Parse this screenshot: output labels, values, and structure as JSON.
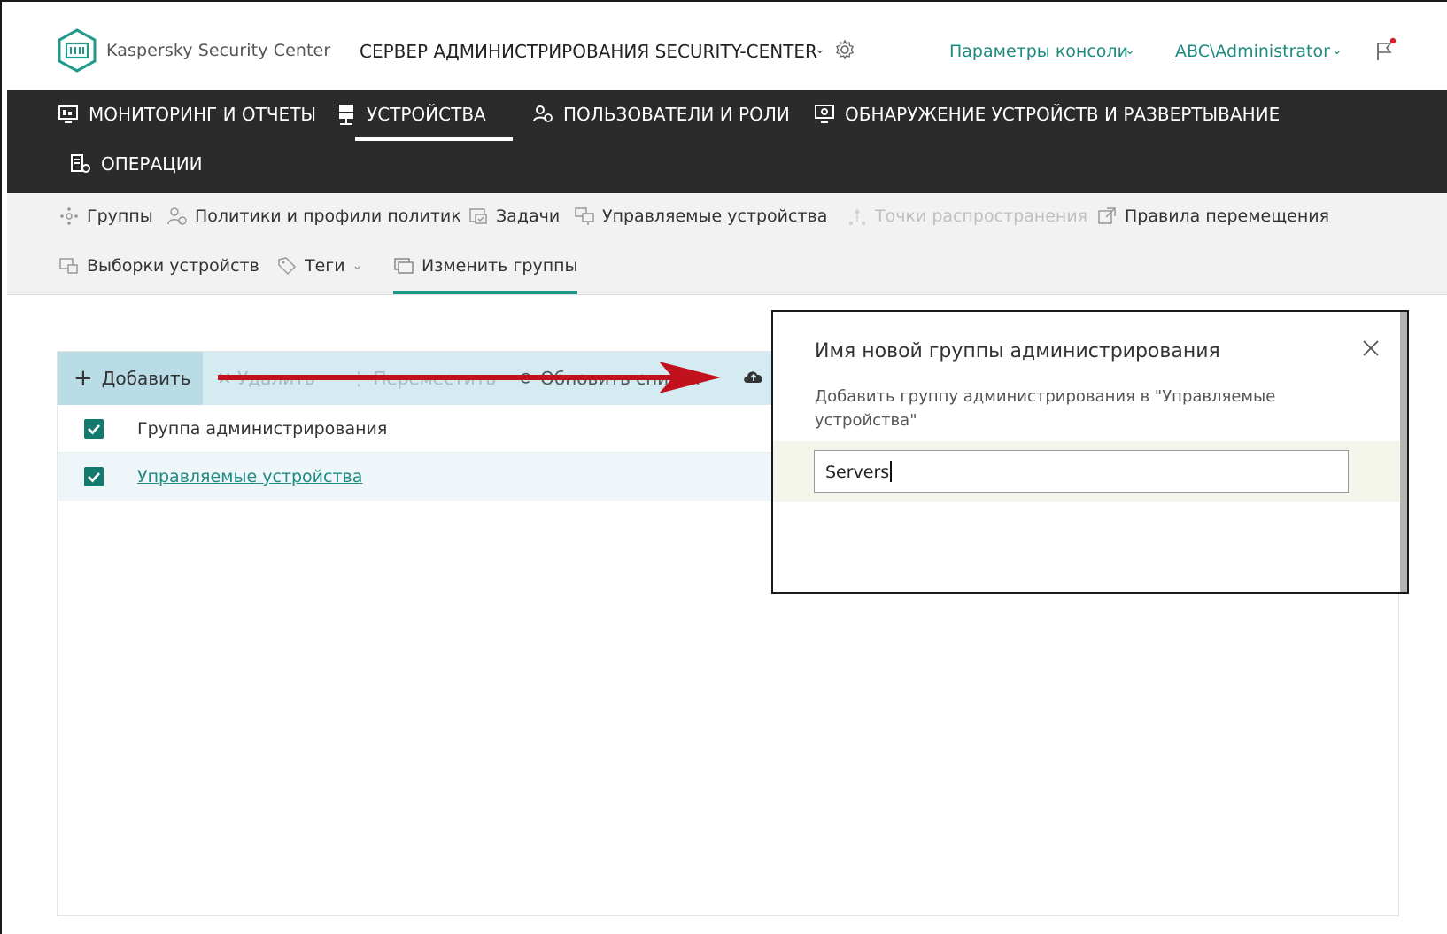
{
  "header": {
    "product_name": "Kaspersky Security Center",
    "server_name": "СЕРВЕР АДМИНИСТРИРОВАНИЯ SECURITY-CENTER",
    "console_settings": "Параметры консоли",
    "user": "ABC\\Administrator"
  },
  "main_nav": {
    "items": [
      {
        "label": "МОНИТОРИНГ И ОТЧЕТЫ",
        "icon": "monitor-icon"
      },
      {
        "label": "УСТРОЙСТВА",
        "icon": "devices-icon",
        "active": true
      },
      {
        "label": "ПОЛЬЗОВАТЕЛИ И РОЛИ",
        "icon": "users-icon"
      },
      {
        "label": "ОБНАРУЖЕНИЕ УСТРОЙСТВ И РАЗВЕРТЫВАНИЕ",
        "icon": "discovery-icon"
      },
      {
        "label": "ОПЕРАЦИИ",
        "icon": "operations-icon"
      }
    ]
  },
  "sub_nav": {
    "items": [
      {
        "label": "Группы",
        "icon": "groups-icon"
      },
      {
        "label": "Политики и профили политик",
        "icon": "policies-icon"
      },
      {
        "label": "Задачи",
        "icon": "tasks-icon"
      },
      {
        "label": "Управляемые устройства",
        "icon": "managed-devices-icon"
      },
      {
        "label": "Точки распространения",
        "icon": "distribution-points-icon",
        "disabled": true
      },
      {
        "label": "Правила перемещения",
        "icon": "external-link-icon"
      },
      {
        "label": "Выборки устройств",
        "icon": "device-selections-icon"
      },
      {
        "label": "Теги",
        "icon": "tags-icon"
      },
      {
        "label": "Изменить группы",
        "icon": "edit-groups-icon",
        "active": true
      }
    ]
  },
  "toolbar": {
    "add": "Добавить",
    "delete": "Удалить",
    "move": "Переместить",
    "refresh": "Обновить список"
  },
  "tree": {
    "rows": [
      {
        "label": "Группа администрирования",
        "checked": true
      },
      {
        "label": "Управляемые устройства",
        "checked": true,
        "link": true
      }
    ]
  },
  "dialog": {
    "title": "Имя новой группы администрирования",
    "description": "Добавить группу администрирования в \"Управляемые устройства\"",
    "input_value": "Servers"
  },
  "colors": {
    "accent": "#1f8a7f",
    "nav_bg": "#2b2b2b",
    "arrow": "#c0111c"
  }
}
